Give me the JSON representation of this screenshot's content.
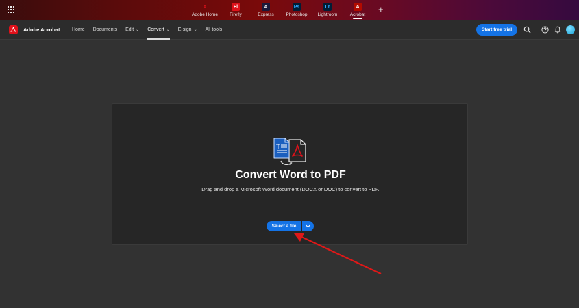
{
  "apps": [
    {
      "label": "Adobe Home",
      "glyph": "A",
      "bg": "transparent",
      "fg": "#e0111a"
    },
    {
      "label": "Firefly",
      "glyph": "Fl",
      "bg": "#e0111a",
      "fg": "#ffffff"
    },
    {
      "label": "Express",
      "glyph": "A",
      "bg": "#1a1a3a",
      "fg": "#ffffff"
    },
    {
      "label": "Photoshop",
      "glyph": "Ps",
      "bg": "#001e36",
      "fg": "#31a8ff"
    },
    {
      "label": "Lightroom",
      "glyph": "Lr",
      "bg": "#001e36",
      "fg": "#31a8ff"
    },
    {
      "label": "Acrobat",
      "glyph": "A",
      "bg": "#b30b00",
      "fg": "#ffffff"
    }
  ],
  "active_app": "Acrobat",
  "brand": {
    "name": "Adobe Acrobat"
  },
  "nav": {
    "items": [
      {
        "label": "Home",
        "dropdown": false
      },
      {
        "label": "Documents",
        "dropdown": false
      },
      {
        "label": "Edit",
        "dropdown": true
      },
      {
        "label": "Convert",
        "dropdown": true
      },
      {
        "label": "E-sign",
        "dropdown": true
      },
      {
        "label": "All tools",
        "dropdown": false
      }
    ],
    "active": "Convert"
  },
  "header": {
    "trial_label": "Start free trial"
  },
  "main": {
    "title": "Convert Word to PDF",
    "subtitle": "Drag and drop a Microsoft Word document (DOCX or DOC) to convert to PDF.",
    "select_label": "Select a file"
  },
  "colors": {
    "accent": "#1473e6",
    "annotation": "#e01818",
    "acrobat_red": "#e0111a"
  },
  "icons": {
    "grid": "app-grid-icon",
    "search": "search-icon",
    "help": "help-icon",
    "bell": "bell-icon",
    "hero": "word-to-pdf-icon",
    "dropdown": "chevron-down-icon"
  }
}
